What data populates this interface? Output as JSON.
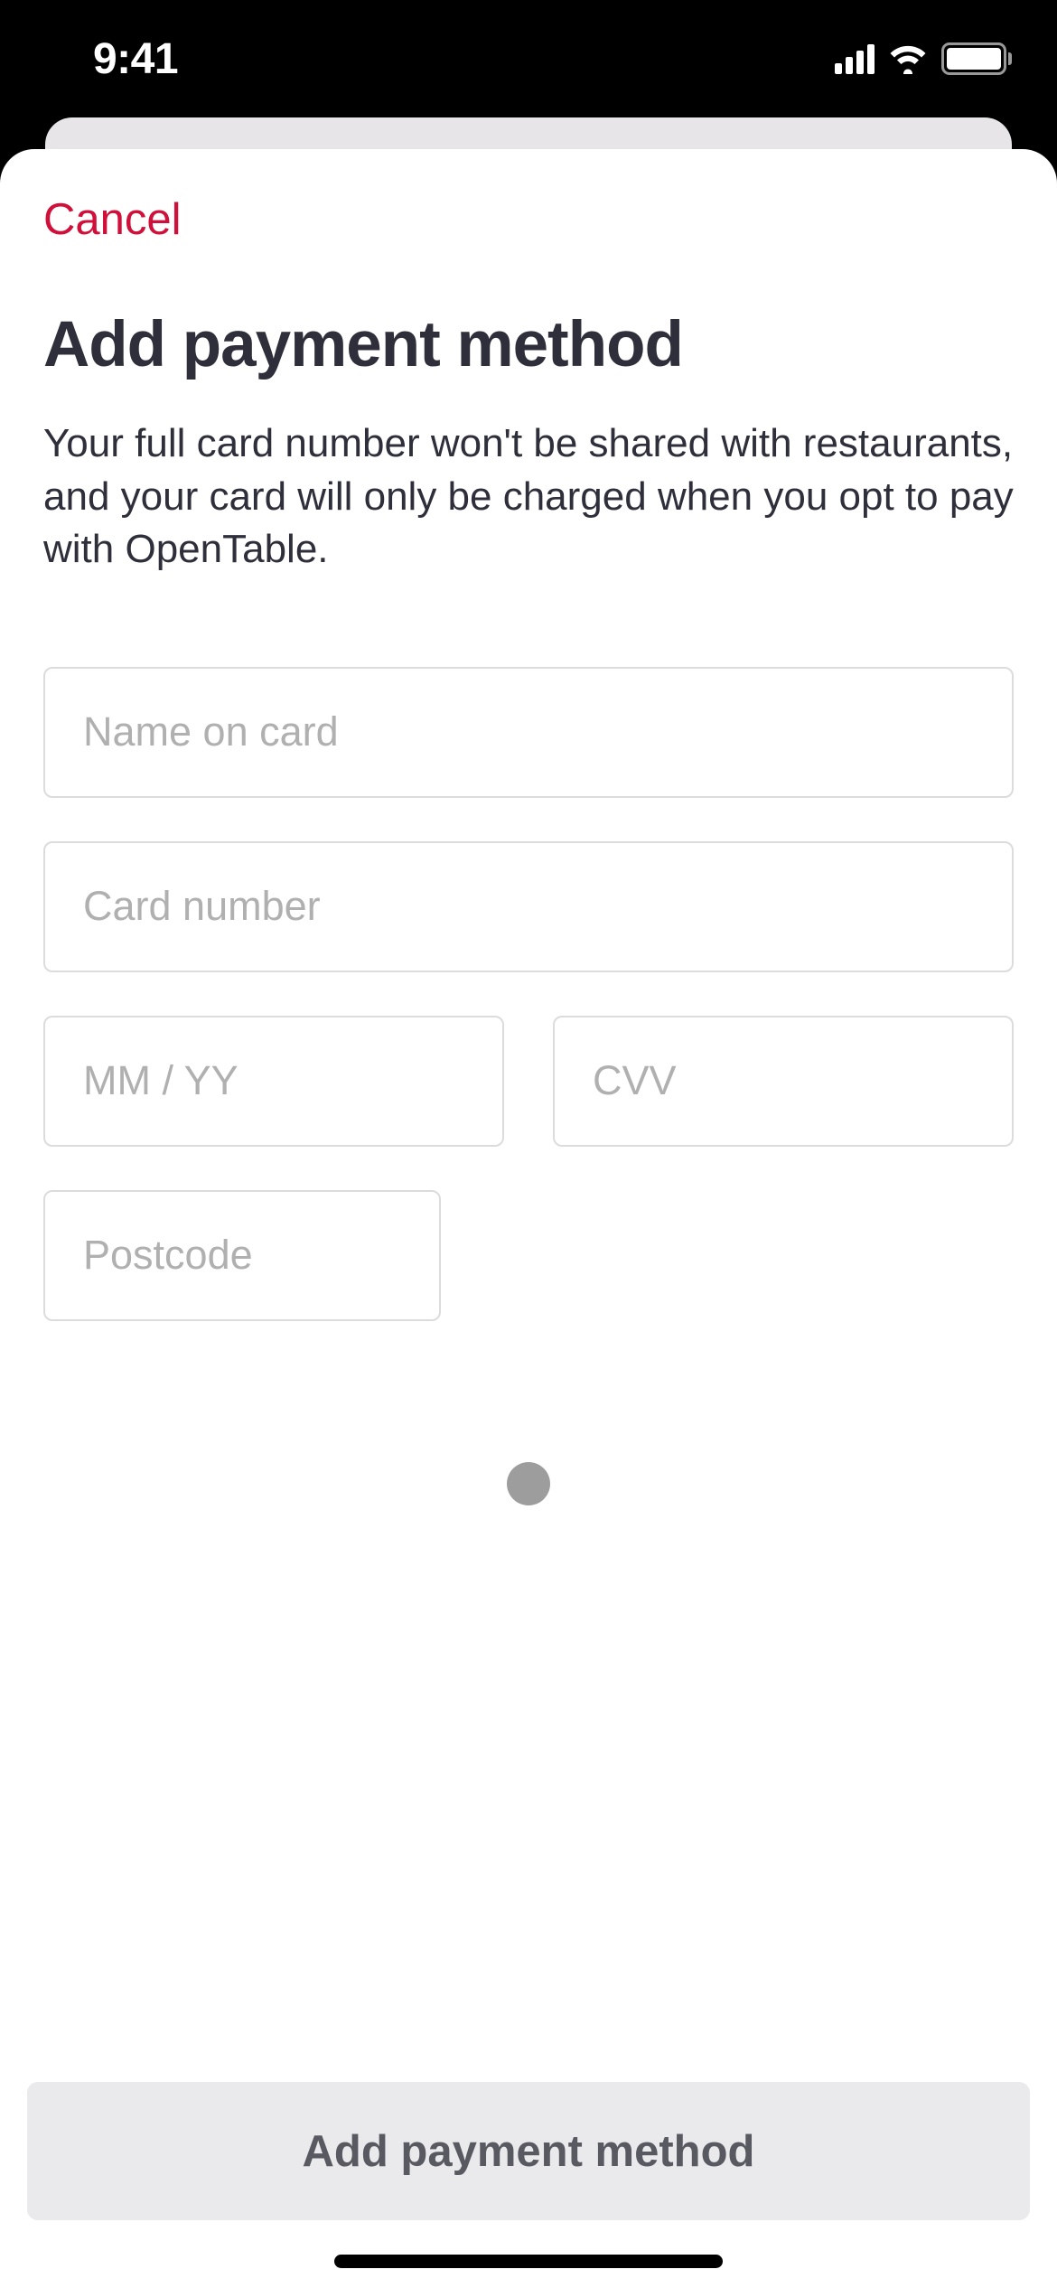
{
  "status_bar": {
    "time": "9:41"
  },
  "sheet": {
    "cancel_label": "Cancel",
    "title": "Add payment method",
    "description": "Your full card number won't be shared with restaurants, and your card will only be charged when you opt to pay with OpenTable.",
    "fields": {
      "name_placeholder": "Name on card",
      "name_value": "",
      "card_number_placeholder": "Card number",
      "card_number_value": "",
      "expiry_placeholder": "MM / YY",
      "expiry_value": "",
      "cvv_placeholder": "CVV",
      "cvv_value": "",
      "postcode_placeholder": "Postcode",
      "postcode_value": ""
    },
    "submit_label": "Add payment method"
  },
  "colors": {
    "accent": "#d0103a",
    "text": "#2f2f3b",
    "placeholder": "#b0b0b0",
    "border": "#dcdcdc",
    "button_bg": "#eaeaec",
    "button_fg": "#595962"
  }
}
